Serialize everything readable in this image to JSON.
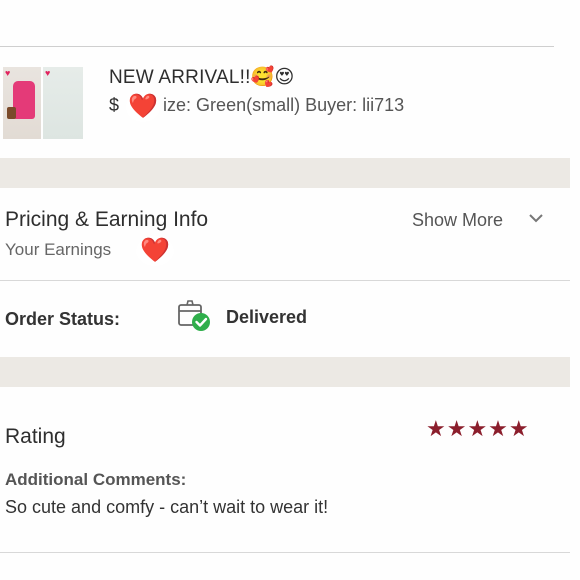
{
  "product": {
    "title": "NEW ARRIVAL!!🥰😍",
    "price_prefix": "$",
    "detail": "ize: Green(small)  Buyer: lii713",
    "heart": "❤️"
  },
  "pricing": {
    "title": "Pricing & Earning Info",
    "earnings_label": "Your Earnings",
    "heart": "❤️",
    "show_more": "Show More"
  },
  "order_status": {
    "label": "Order Status:",
    "value": "Delivered"
  },
  "rating": {
    "label": "Rating",
    "stars": "★★★★★",
    "star_count": 5,
    "star_color": "#8b1e2c",
    "comments_label": "Additional Comments:",
    "comments": "So cute and comfy - can’t wait to wear it!"
  }
}
